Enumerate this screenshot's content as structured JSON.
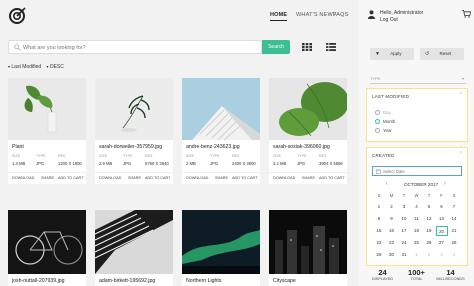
{
  "nav": {
    "home": "HOME",
    "whats_new": "WHAT'S NEW?",
    "faqs": "FAQS"
  },
  "user": {
    "greeting": "Hello, Administrator",
    "logout": "Log Out"
  },
  "search": {
    "placeholder": "What are you looking for?",
    "button": "Search"
  },
  "sort": {
    "field": "Last Modified",
    "order": "DESC"
  },
  "meta_labels": {
    "size": "SIZE",
    "type": "TYPE",
    "res": "RES"
  },
  "actions": {
    "download": "DOWNLOAD",
    "share": "SHARE",
    "add_to_cart": "ADD TO CART"
  },
  "cards_row1": [
    {
      "title": "Plant",
      "size": "1.4 MB",
      "type": "JPG",
      "res": "1200 X 1800"
    },
    {
      "title": "sarah-dorweiler-357959.jpg",
      "size": "2.9 MB",
      "type": "JPG",
      "res": "5760 X 3840"
    },
    {
      "title": "andre-benz-243623.jpg",
      "size": "2 MB",
      "type": "JPG",
      "res": "2400 X 3600"
    },
    {
      "title": "sarah-sosiak-396060.jpg",
      "size": "3.2 MB",
      "type": "JPG",
      "res": "3904 X 5856"
    }
  ],
  "cards_row2": [
    {
      "title": "josh-nuttall-207939.jpg"
    },
    {
      "title": "adam-birkett-195692.jpg"
    },
    {
      "title": "Northern Lights"
    },
    {
      "title": "Cityscape"
    }
  ],
  "sidebar": {
    "apply": "Apply",
    "reset": "Reset",
    "type_label": "TYPE",
    "last_modified": {
      "title": "LAST MODIFIED",
      "options": [
        "Day",
        "Month",
        "Year"
      ],
      "selected": "Month"
    },
    "created": {
      "title": "CREATED",
      "placeholder": "Select Date",
      "month": "OCTOBER 2017",
      "dow": [
        "S",
        "M",
        "T",
        "W",
        "T",
        "F",
        "S"
      ],
      "weeks": [
        [
          "1",
          "2",
          "3",
          "4",
          "5",
          "6",
          "7"
        ],
        [
          "8",
          "9",
          "10",
          "11",
          "12",
          "13",
          "14"
        ],
        [
          "15",
          "16",
          "17",
          "18",
          "19",
          "20",
          "21"
        ],
        [
          "22",
          "23",
          "24",
          "25",
          "26",
          "27",
          "28"
        ],
        [
          "29",
          "30",
          "31",
          "1",
          "2",
          "3",
          "4"
        ]
      ],
      "today": "20"
    }
  },
  "stats": [
    {
      "num": "24",
      "label": "DISPLAYED"
    },
    {
      "num": "100+",
      "label": "TOTAL"
    },
    {
      "num": "14",
      "label": "MILLISECONDS"
    }
  ],
  "colors": {
    "accent": "#3bbf94",
    "panel_border": "#f3e58c",
    "link": "#5aa2c9"
  }
}
